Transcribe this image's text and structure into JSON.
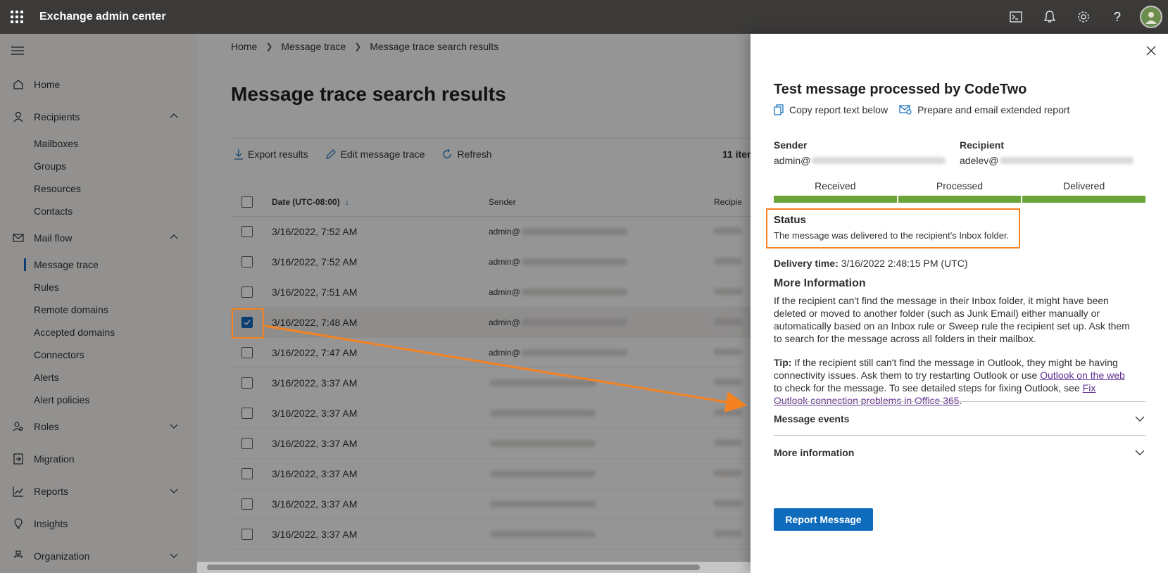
{
  "topbar": {
    "title": "Exchange admin center",
    "icons": [
      "waffle-icon",
      "terminal-icon",
      "bell-icon",
      "gear-icon",
      "help-icon"
    ]
  },
  "nav": {
    "items": [
      {
        "label": "Home",
        "icon": "home-icon"
      },
      {
        "label": "Recipients",
        "icon": "person-icon",
        "expanded": true,
        "children": [
          "Mailboxes",
          "Groups",
          "Resources",
          "Contacts"
        ]
      },
      {
        "label": "Mail flow",
        "icon": "mail-icon",
        "expanded": true,
        "children": [
          "Message trace",
          "Rules",
          "Remote domains",
          "Accepted domains",
          "Connectors",
          "Alerts",
          "Alert policies"
        ]
      },
      {
        "label": "Roles",
        "icon": "roles-icon",
        "expanded": false
      },
      {
        "label": "Migration",
        "icon": "migration-icon"
      },
      {
        "label": "Reports",
        "icon": "reports-icon",
        "expanded": false
      },
      {
        "label": "Insights",
        "icon": "lightbulb-icon"
      },
      {
        "label": "Organization",
        "icon": "org-icon",
        "expanded": false
      }
    ],
    "active": "Message trace"
  },
  "breadcrumb": [
    "Home",
    "Message trace",
    "Message trace search results"
  ],
  "page_title": "Message trace search results",
  "toolbar": {
    "export": "Export results",
    "edit": "Edit message trace",
    "refresh": "Refresh",
    "count": "11 iter"
  },
  "table": {
    "columns": [
      "Date (UTC-08:00)",
      "Sender",
      "Recipie"
    ],
    "rows": [
      {
        "date": "3/16/2022, 7:52 AM",
        "sender": "admin@",
        "selected": false
      },
      {
        "date": "3/16/2022, 7:52 AM",
        "sender": "admin@",
        "selected": false
      },
      {
        "date": "3/16/2022, 7:51 AM",
        "sender": "admin@",
        "selected": false
      },
      {
        "date": "3/16/2022, 7:48 AM",
        "sender": "admin@",
        "selected": true
      },
      {
        "date": "3/16/2022, 7:47 AM",
        "sender": "admin@",
        "selected": false
      },
      {
        "date": "3/16/2022, 3:37 AM",
        "sender": "",
        "selected": false
      },
      {
        "date": "3/16/2022, 3:37 AM",
        "sender": "",
        "selected": false
      },
      {
        "date": "3/16/2022, 3:37 AM",
        "sender": "",
        "selected": false
      },
      {
        "date": "3/16/2022, 3:37 AM",
        "sender": "",
        "selected": false
      },
      {
        "date": "3/16/2022, 3:37 AM",
        "sender": "",
        "selected": false
      },
      {
        "date": "3/16/2022, 3:37 AM",
        "sender": "",
        "selected": false
      }
    ]
  },
  "panel": {
    "title": "Test message processed by CodeTwo",
    "copy_action": "Copy report text below",
    "email_action": "Prepare and email extended report",
    "sender_label": "Sender",
    "sender_value": "admin@",
    "recipient_label": "Recipient",
    "recipient_value": "adelev@",
    "stages": [
      "Received",
      "Processed",
      "Delivered"
    ],
    "stage_color": "#6ba539",
    "status_title": "Status",
    "status_text": "The message was delivered to the recipient's Inbox folder.",
    "delivery_label": "Delivery time:",
    "delivery_value": "3/16/2022 2:48:15 PM (UTC)",
    "more_title": "More Information",
    "more_text": "If the recipient can't find the message in their Inbox folder, it might have been deleted or moved to another folder (such as Junk Email) either manually or automatically based on an Inbox rule or Sweep rule the recipient set up. Ask them to search for the message across all folders in their mailbox.",
    "tip_label": "Tip:",
    "tip_text_1": "If the recipient still can't find the message in Outlook, they might be having connectivity issues. Ask them to try restarting Outlook or use",
    "tip_link_1": "Outlook on the web",
    "tip_text_2": "to check for the message. To see detailed steps for fixing Outlook, see",
    "tip_link_2": "Fix Outlook connection problems in Office 365",
    "tip_text_3": ".",
    "accordion_1": "Message events",
    "accordion_2": "More information",
    "report_button": "Report Message"
  },
  "colors": {
    "accent": "#0f6cbd",
    "highlight": "#f58220",
    "topbar": "#3b3a39"
  }
}
